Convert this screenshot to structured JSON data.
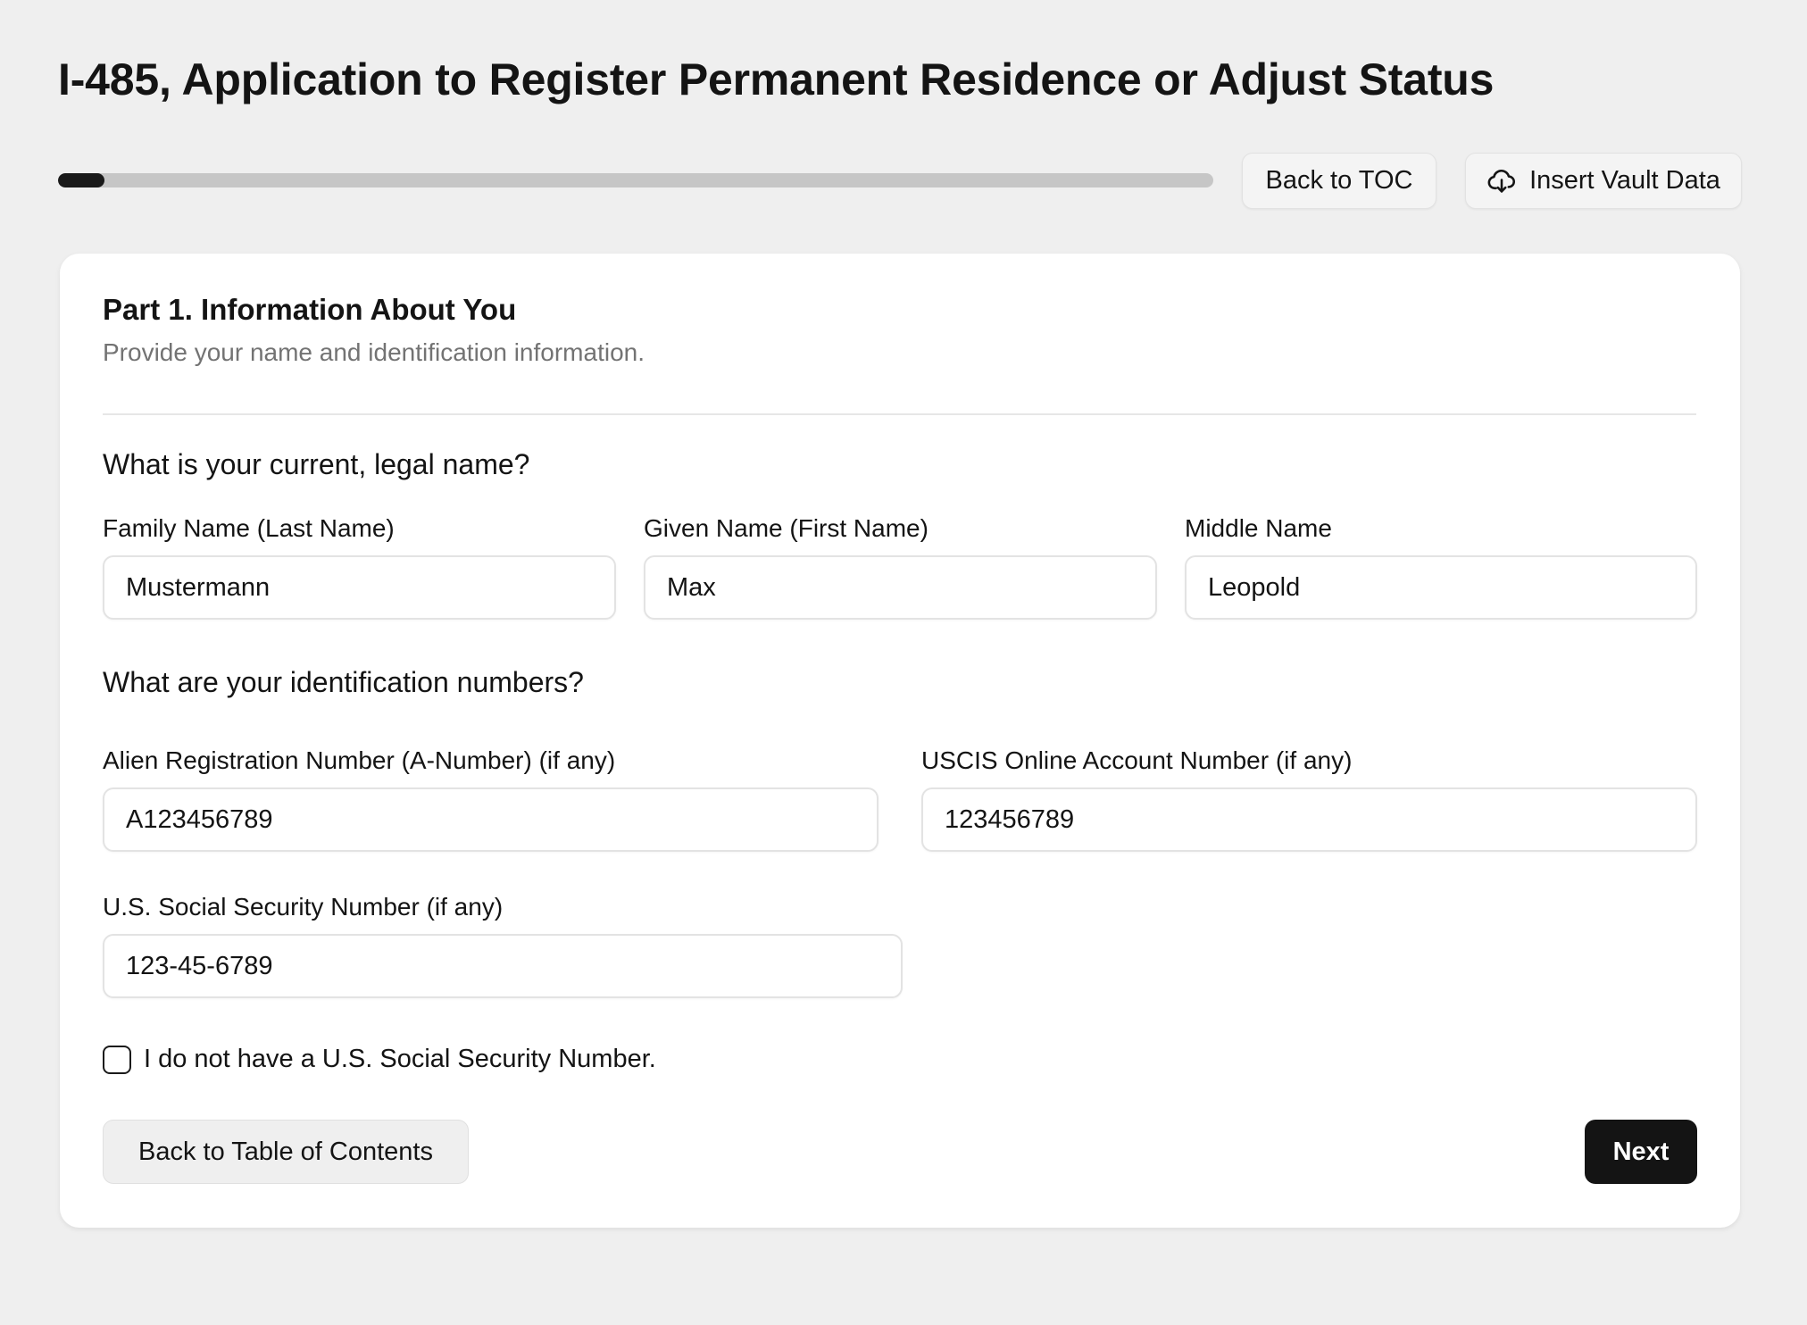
{
  "page": {
    "title": "I-485, Application to Register Permanent Residence or Adjust Status"
  },
  "progress": {
    "percent": 4
  },
  "toolbar": {
    "back_to_toc_label": "Back to TOC",
    "insert_vault_label": "Insert Vault Data",
    "insert_vault_icon": "cloud-download-icon"
  },
  "part": {
    "title": "Part 1. Information About You",
    "subtitle": "Provide your name and identification information."
  },
  "name_section": {
    "question": "What is your current, legal name?",
    "family_name": {
      "label": "Family Name (Last Name)",
      "value": "Mustermann"
    },
    "given_name": {
      "label": "Given Name (First Name)",
      "value": "Max"
    },
    "middle_name": {
      "label": "Middle Name",
      "value": "Leopold"
    }
  },
  "id_section": {
    "question": "What are your identification numbers?",
    "a_number": {
      "label": "Alien Registration Number (A-Number) (if any)",
      "value": "A123456789"
    },
    "uscis_account": {
      "label": "USCIS Online Account Number (if any)",
      "value": "123456789"
    },
    "ssn": {
      "label": "U.S. Social Security Number (if any)",
      "value": "123-45-6789"
    },
    "no_ssn_checkbox": {
      "label": "I do not have a U.S. Social Security Number.",
      "checked": false
    }
  },
  "footer": {
    "back_label": "Back to Table of Contents",
    "next_label": "Next"
  },
  "colors": {
    "background": "#efefef",
    "card": "#ffffff",
    "primary": "#141414",
    "muted_text": "#737373"
  }
}
